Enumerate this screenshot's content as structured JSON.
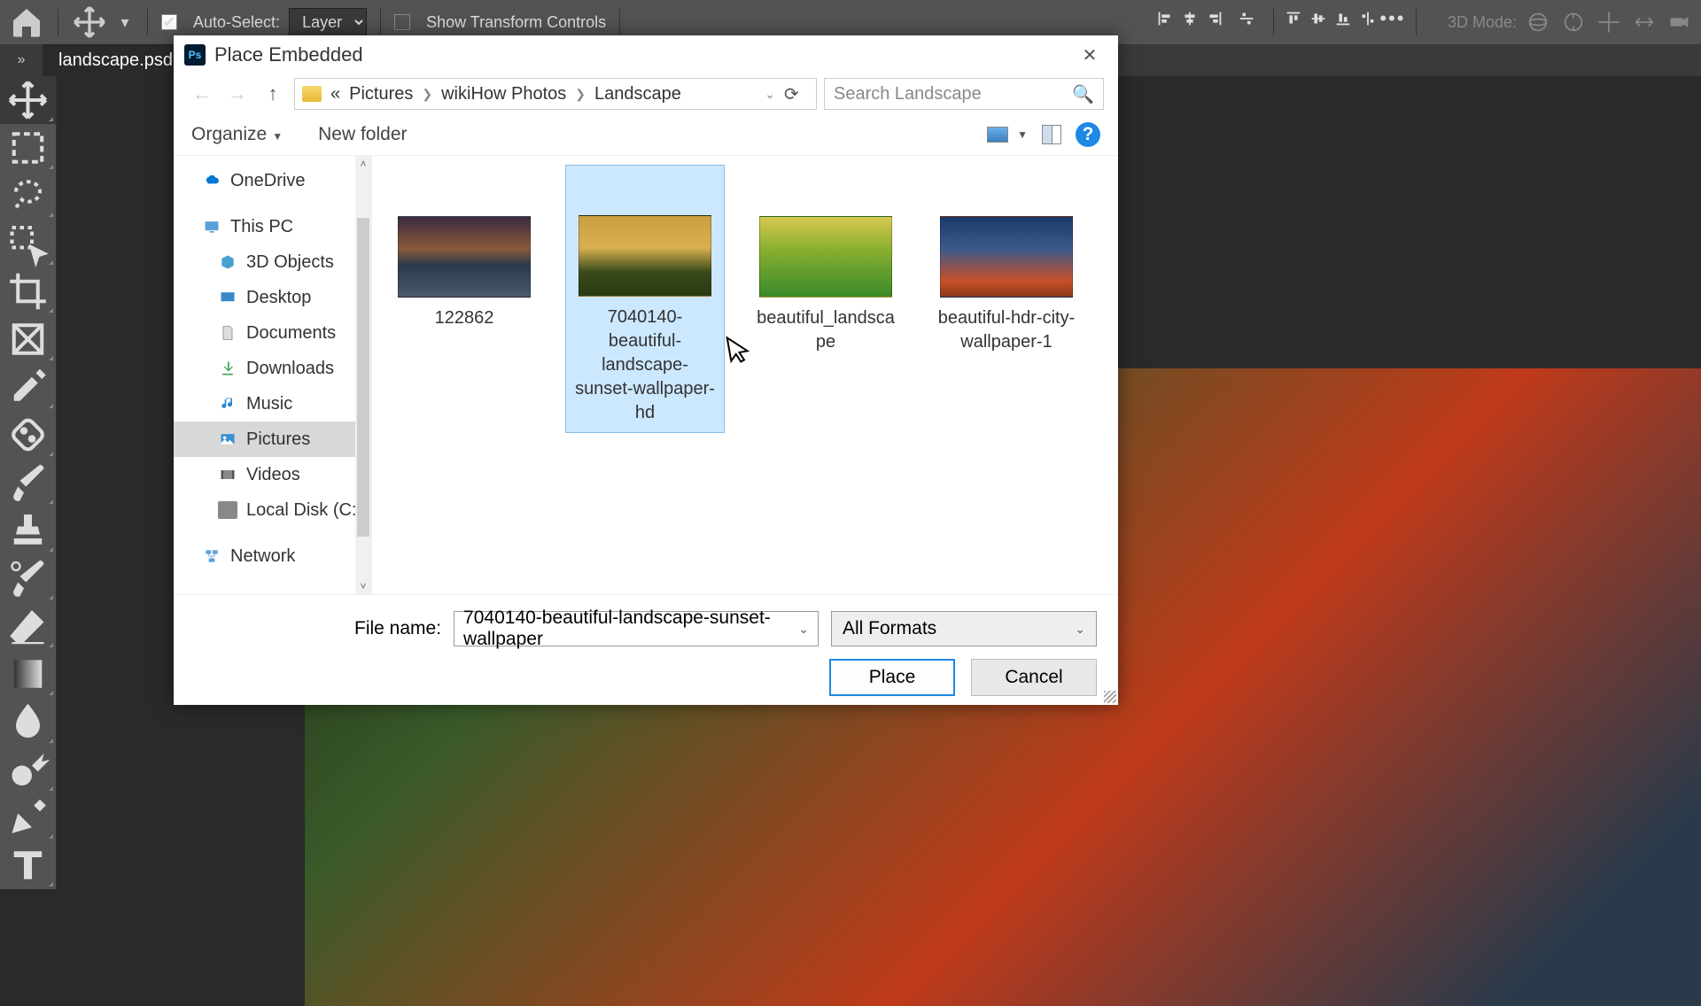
{
  "toolbar": {
    "auto_select": "Auto-Select:",
    "layer": "Layer",
    "show_transform": "Show Transform Controls",
    "mode_3d": "3D Mode:"
  },
  "doc_tab": "landscape.psd",
  "dialog": {
    "title": "Place Embedded",
    "breadcrumb": [
      "Pictures",
      "wikiHow Photos",
      "Landscape"
    ],
    "search_placeholder": "Search Landscape",
    "organize": "Organize",
    "new_folder": "New folder",
    "tree": {
      "onedrive": "OneDrive",
      "this_pc": "This PC",
      "objects_3d": "3D Objects",
      "desktop": "Desktop",
      "documents": "Documents",
      "downloads": "Downloads",
      "music": "Music",
      "pictures": "Pictures",
      "videos": "Videos",
      "local_disk": "Local Disk (C:)",
      "network": "Network"
    },
    "files": [
      {
        "name": "122862"
      },
      {
        "name": "7040140-beautiful-landscape-sunset-wallpaper-hd",
        "selected": true
      },
      {
        "name": "beautiful_landscape"
      },
      {
        "name": "beautiful-hdr-city-wallpaper-1"
      }
    ],
    "file_name_label": "File name:",
    "file_name_value": "7040140-beautiful-landscape-sunset-wallpaper",
    "format": "All Formats",
    "place": "Place",
    "cancel": "Cancel"
  }
}
